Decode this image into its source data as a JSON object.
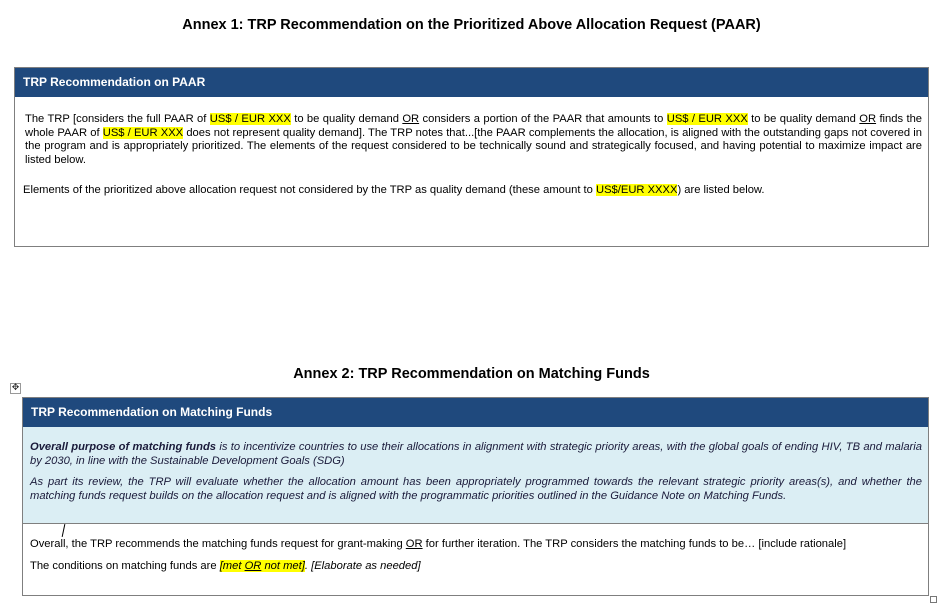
{
  "annex1": {
    "title": "Annex 1: TRP Recommendation on the Prioritized Above Allocation Request (PAAR)",
    "header": "TRP Recommendation on PAAR",
    "p1_a": "The TRP [considers the full PAAR of ",
    "p1_hl1": "US$ / EUR XXX",
    "p1_b": " to be quality demand ",
    "p1_or1": "OR",
    "p1_c": " considers a portion of the PAAR that amounts to ",
    "p1_hl2": "US$ / EUR XXX",
    "p1_d": " to be quality demand ",
    "p1_or2": "OR",
    "p1_e": " finds the whole PAAR of ",
    "p1_hl3": "US$ / EUR XXX",
    "p1_f": " does not represent quality demand]. The TRP notes that...[the PAAR complements the allocation, is aligned with the outstanding gaps not covered in the program and is appropriately prioritized. The elements of the request  considered to be technically sound and strategically focused, and having potential to maximize impact are listed below.",
    "p2_a": "Elements of the prioritized above allocation request not considered by the TRP as quality demand (these amount to ",
    "p2_hl": "US$/EUR XXXX",
    "p2_b": ") are listed below."
  },
  "annex2": {
    "title": "Annex 2:  TRP Recommendation on Matching Funds",
    "header": "TRP Recommendation on Matching Funds",
    "purpose_bold": "Overall purpose of matching funds",
    "purpose_rest": " is to incentivize countries to use their allocations in alignment with strategic priority areas, with the global goals of ending HIV, TB and malaria by 2030, in line with the Sustainable Development Goals (SDG)",
    "review": "As part its review, the TRP will evaluate whether the allocation amount has been appropriately programmed towards the relevant strategic priority areas(s), and whether the matching funds request builds on the allocation request and is aligned with the programmatic priorities outlined in the Guidance Note on Matching Funds.",
    "overall_a": "Overall, the TRP recommends the matching funds request for grant-making ",
    "overall_or": "OR",
    "overall_b": " for further iteration. The TRP considers the matching funds to be… [include rationale]",
    "cond_a": "The conditions on matching funds are ",
    "cond_hl_a": "[met ",
    "cond_hl_or": "OR",
    "cond_hl_b": " not met]",
    "cond_b": ". [Elaborate as needed]"
  },
  "colors": {
    "header_bg": "#1f497d",
    "guidance_bg": "#dbeef4",
    "highlight": "#ffff00"
  }
}
